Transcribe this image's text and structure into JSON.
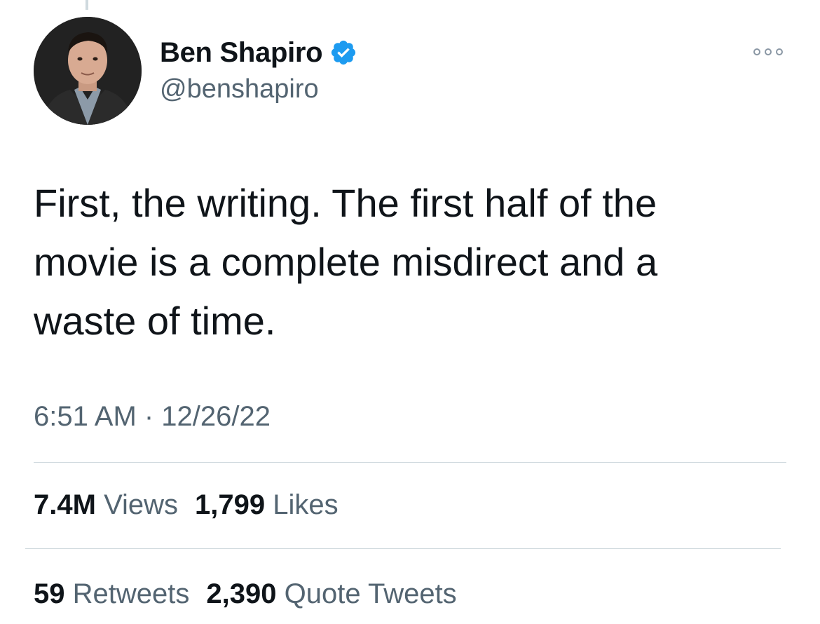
{
  "tweet": {
    "author": {
      "display_name": "Ben Shapiro",
      "handle": "@benshapiro",
      "verified": true
    },
    "text_lines": [
      "First, the writing. The first half of the",
      "movie is a complete misdirect and a",
      "waste of time."
    ],
    "timestamp": "6:51 AM · 12/26/22",
    "stats": {
      "views": {
        "count": "7.4M",
        "label": "Views"
      },
      "likes": {
        "count": "1,799",
        "label": "Likes"
      },
      "retweets": {
        "count": "59",
        "label": "Retweets"
      },
      "quote_tweets": {
        "count": "2,390",
        "label": "Quote Tweets"
      }
    }
  },
  "icons": {
    "verified": "verified-badge-icon",
    "more": "more-options-icon"
  },
  "colors": {
    "text_primary": "#0f1419",
    "text_secondary": "#536471",
    "verified_blue": "#1d9bf0",
    "divider": "#cfd9de"
  }
}
